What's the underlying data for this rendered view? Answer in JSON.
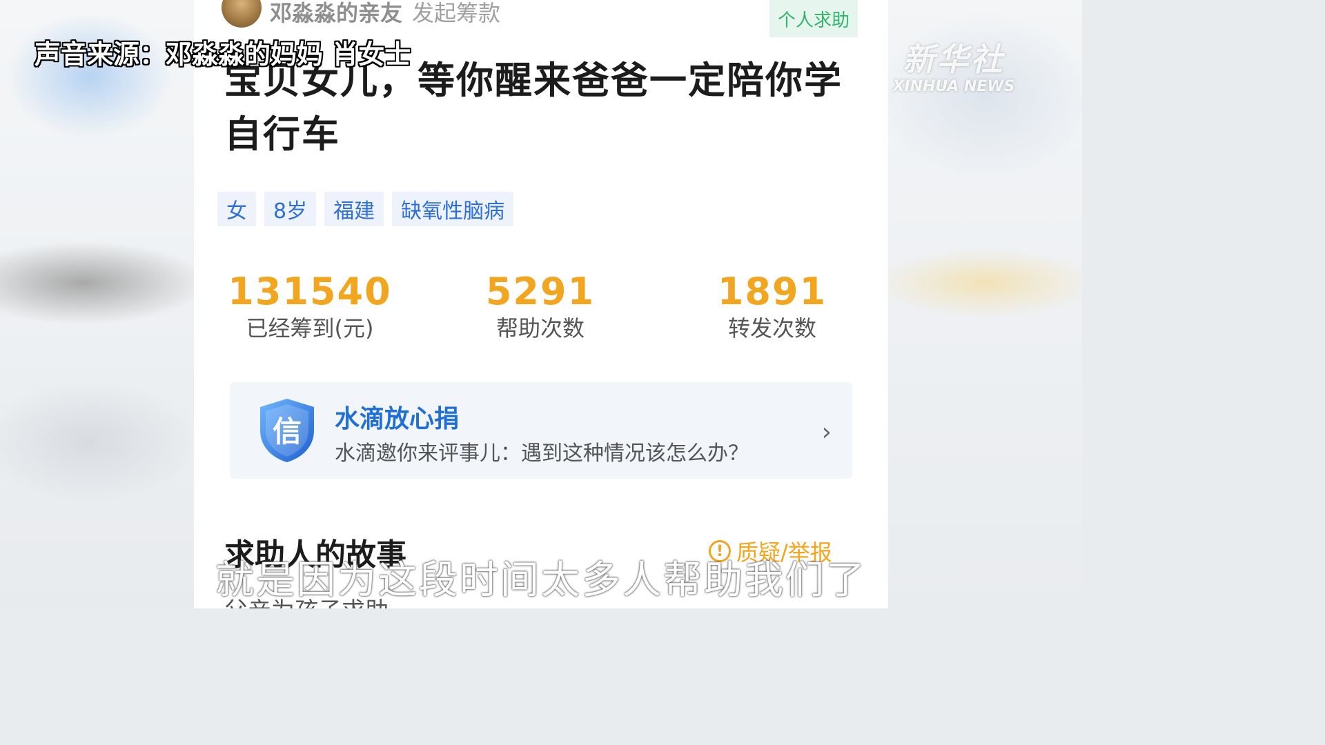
{
  "overlay": {
    "source_caption": "声音来源：邓淼淼的妈妈 肖女士",
    "subtitle": "就是因为这段时间太多人帮助我们了"
  },
  "watermark": {
    "cn": "新华社",
    "en": "XINHUA NEWS"
  },
  "header": {
    "initiator_name": "邓淼淼的亲友",
    "initiator_action": "发起筹款",
    "type_badge": "个人求助"
  },
  "campaign": {
    "title": "宝贝女儿，等你醒来爸爸一定陪你学自行车",
    "tags": [
      "女",
      "8岁",
      "福建",
      "缺氧性脑病"
    ]
  },
  "stats": [
    {
      "value": "131540",
      "label": "已经筹到(元)"
    },
    {
      "value": "5291",
      "label": "帮助次数"
    },
    {
      "value": "1891",
      "label": "转发次数"
    }
  ],
  "trust_card": {
    "icon_char": "信",
    "title": "水滴放心捐",
    "description": "水滴邀你来评事儿：遇到这种情况该怎么办？",
    "icon": "shield-icon",
    "chevron": "›"
  },
  "story": {
    "title": "求助人的故事",
    "report_label": "质疑/举报",
    "report_icon": "!",
    "first_line": "父亲为孩子求助"
  },
  "colors": {
    "accent_blue": "#2f6fd6",
    "accent_orange": "#f2a51f",
    "badge_green": "#34b36b"
  }
}
